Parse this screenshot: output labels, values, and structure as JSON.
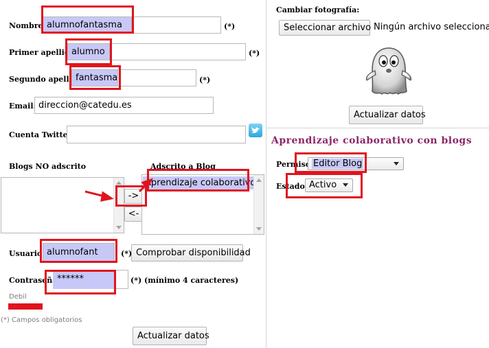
{
  "form": {
    "nombre_label": "Nombre:",
    "nombre_value": "alumnofantasma",
    "primer_apellido_label": "Primer apellido:",
    "primer_apellido_value": "alumno",
    "segundo_apellido_label": "Segundo apellido:",
    "segundo_apellido_value": "fantasma",
    "email_label": "Email:",
    "email_value": "direccion@catedu.es",
    "twitter_label": "Cuenta Twitter:",
    "twitter_value": "",
    "required_mark": "(*)",
    "blogs_no_label": "Blogs NO adscrito",
    "blogs_adscrito_label": "Adscrito a Blog",
    "adscrito_items": [
      "Aprendizaje colaborativo con blogs"
    ],
    "add_button": "->",
    "remove_button": "<-",
    "usuario_label": "Usuario:",
    "usuario_value": "alumnofant",
    "comprobar_button": "Comprobar disponibilidad",
    "password_label": "Contraseña:",
    "password_value": "******",
    "password_hint": "(*) (mínimo 4 caracteres)",
    "strength_text": "Debil",
    "strength_color": "#e0141e",
    "required_note": "(*) Campos obligatorios",
    "submit_button": "Actualizar datos"
  },
  "photo": {
    "label": "Cambiar fotografía:",
    "file_button": "Seleccionar archivo",
    "file_status": "Ningún archivo seleccionado",
    "avatar_icon": "ghost-avatar",
    "update_button": "Actualizar datos"
  },
  "blog": {
    "title": "Aprendizaje colaborativo con blogs",
    "title_color": "#8b2566",
    "permiso_label": "Permiso:",
    "permiso_value": "Editor Blog",
    "estado_label": "Estado:",
    "estado_value": "Activo"
  },
  "annotation": {
    "highlight_color": "#e0141e",
    "fill_color": "#c8c8f8"
  }
}
